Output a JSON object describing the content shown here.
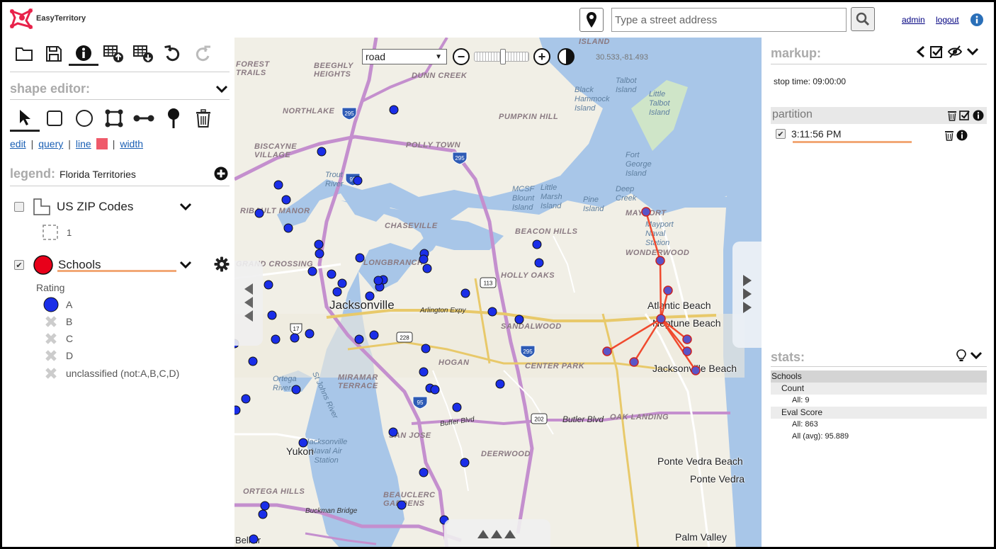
{
  "app": {
    "name": "EasyTerritory"
  },
  "header": {
    "address_placeholder": "Type a street address",
    "admin_label": "admin",
    "logout_label": "logout"
  },
  "shape_editor": {
    "title": "shape editor:",
    "links": {
      "edit": "edit",
      "query": "query",
      "line": "line",
      "width": "width"
    },
    "line_color": "#ef5a6a"
  },
  "legend": {
    "title": "legend:",
    "name": "Florida Territories",
    "layers": [
      {
        "name": "US ZIP Codes",
        "checked": false,
        "sub_label": "1"
      },
      {
        "name": "Schools",
        "checked": true,
        "color": "#e8001a"
      }
    ],
    "rating_title": "Rating",
    "ratings": [
      {
        "label": "A",
        "color": "#1a2ee8"
      },
      {
        "label": "B"
      },
      {
        "label": "C"
      },
      {
        "label": "D"
      },
      {
        "label": "unclassified (not:A,B,C,D)"
      }
    ]
  },
  "map": {
    "basemap": "road",
    "coords": "30.533,-81.493",
    "labels": {
      "forest_trails": "FOREST\nTRAILS",
      "beeghly_heights": "BEEGHLY\nHEIGHTS",
      "dunn_creek": "DUNN CREEK",
      "northlake": "NORTHLAKE",
      "pumpkin_hill": "PUMPKIN HILL",
      "biscayne_village": "BISCAYNE\nVILLAGE",
      "polly_town": "POLLY TOWN",
      "ribault_manor": "RIBAULT MANOR",
      "chaseville": "CHASEVILLE",
      "beacon_hills": "BEACON HILLS",
      "grand_crossing": "GRAND CROSSING",
      "longbranch": "LONGBRANCH",
      "holly_oaks": "HOLLY OAKS",
      "wonderwood": "WONDERWOOD",
      "mayport": "MAYPORT",
      "sandalwood": "SANDALWOOD",
      "hogan": "HOGAN",
      "center_park": "CENTER PARK",
      "miramar_terrace": "MIRAMAR\nTERRACE",
      "san_jose": "SAN JOSE",
      "deerwood": "DEERWOOD",
      "oak_landing": "OAK LANDING",
      "ortega_hills": "ORTEGA HILLS",
      "beauclerc_gardens": "BEAUCLERC\nGARDENS",
      "ortega_river": "Ortega\nRiver",
      "jacksonville_naval": "Jacksonville\nNaval Air\nStation",
      "trout_river": "Trout\nRiver",
      "mcsf_blount": "MCSF\nBlount\nIsland",
      "little_marsh": "Little\nMarsh\nIsland",
      "pine_island": "Pine\nIsland",
      "deep_creek": "Deep\nCreek",
      "fort_george": "Fort\nGeorge\nIsland",
      "hammock": "Black\nHammock\nIsland",
      "talbot": "Talbot\nIsland",
      "little_talbot": "Little\nTalbot\nIsland",
      "mayport_naval": "Mayport\nNaval\nStation",
      "st_johns_river": "St Johns River",
      "island_top": "ISLAND"
    },
    "cities": {
      "jacksonville": "Jacksonville",
      "atlantic_beach": "Atlantic Beach",
      "neptune_beach": "Neptune Beach",
      "jacksonville_beach": "Jacksonville Beach",
      "yukon": "Yukon",
      "ponte_vedra_beach": "Ponte Vedra Beach",
      "ponte_vedra": "Ponte Vedra",
      "palm_valley": "Palm Valley",
      "bellair": "Bellair"
    },
    "roads": {
      "arlington_expy": "Arlington Expy",
      "buffer_blvd": "Buffer Blvd",
      "butler_blvd": "Butler Blvd",
      "buckman_bridge": "Buckman Bridge"
    },
    "shields": [
      "295",
      "295",
      "95",
      "113",
      "228",
      "17",
      "295",
      "95",
      "202"
    ]
  },
  "markup": {
    "title": "markup:",
    "stop_time": "stop time: 09:00:00",
    "partition_title": "partition",
    "partition_item": "3:11:56 PM"
  },
  "stats": {
    "title": "stats:",
    "layer": "Schools",
    "count_label": "Count",
    "count_all": "All: 9",
    "eval_label": "Eval Score",
    "eval_all": "All: 863",
    "eval_avg": "All (avg): 95.889"
  }
}
